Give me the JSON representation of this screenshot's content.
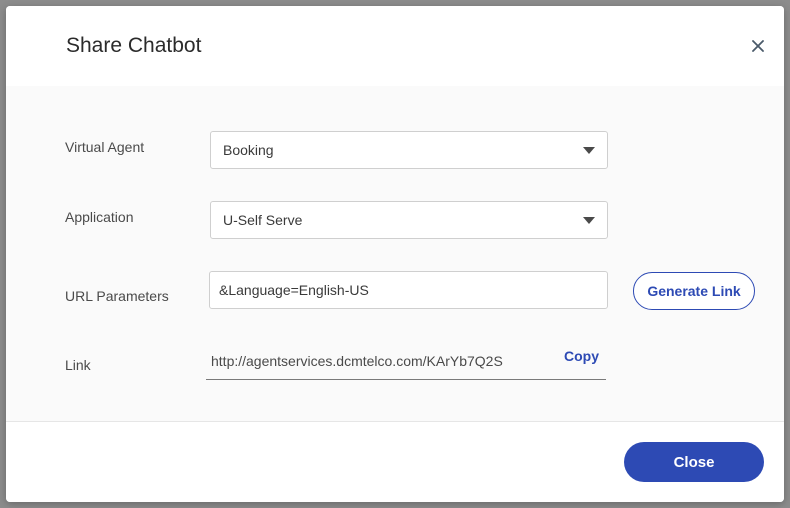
{
  "modal": {
    "title": "Share Chatbot",
    "close_icon": "close-icon"
  },
  "form": {
    "virtual_agent": {
      "label": "Virtual Agent",
      "value": "Booking"
    },
    "application": {
      "label": "Application",
      "value": "U-Self Serve"
    },
    "url_parameters": {
      "label": "URL Parameters",
      "value": "&Language=English-US",
      "generate_label": "Generate Link"
    },
    "link": {
      "label": "Link",
      "value": "http://agentservices.dcmtelco.com/KArYb7Q2S",
      "copy_label": "Copy"
    }
  },
  "footer": {
    "close_label": "Close"
  },
  "colors": {
    "accent": "#2d4ab4",
    "backdrop": "#8c8c8c"
  }
}
